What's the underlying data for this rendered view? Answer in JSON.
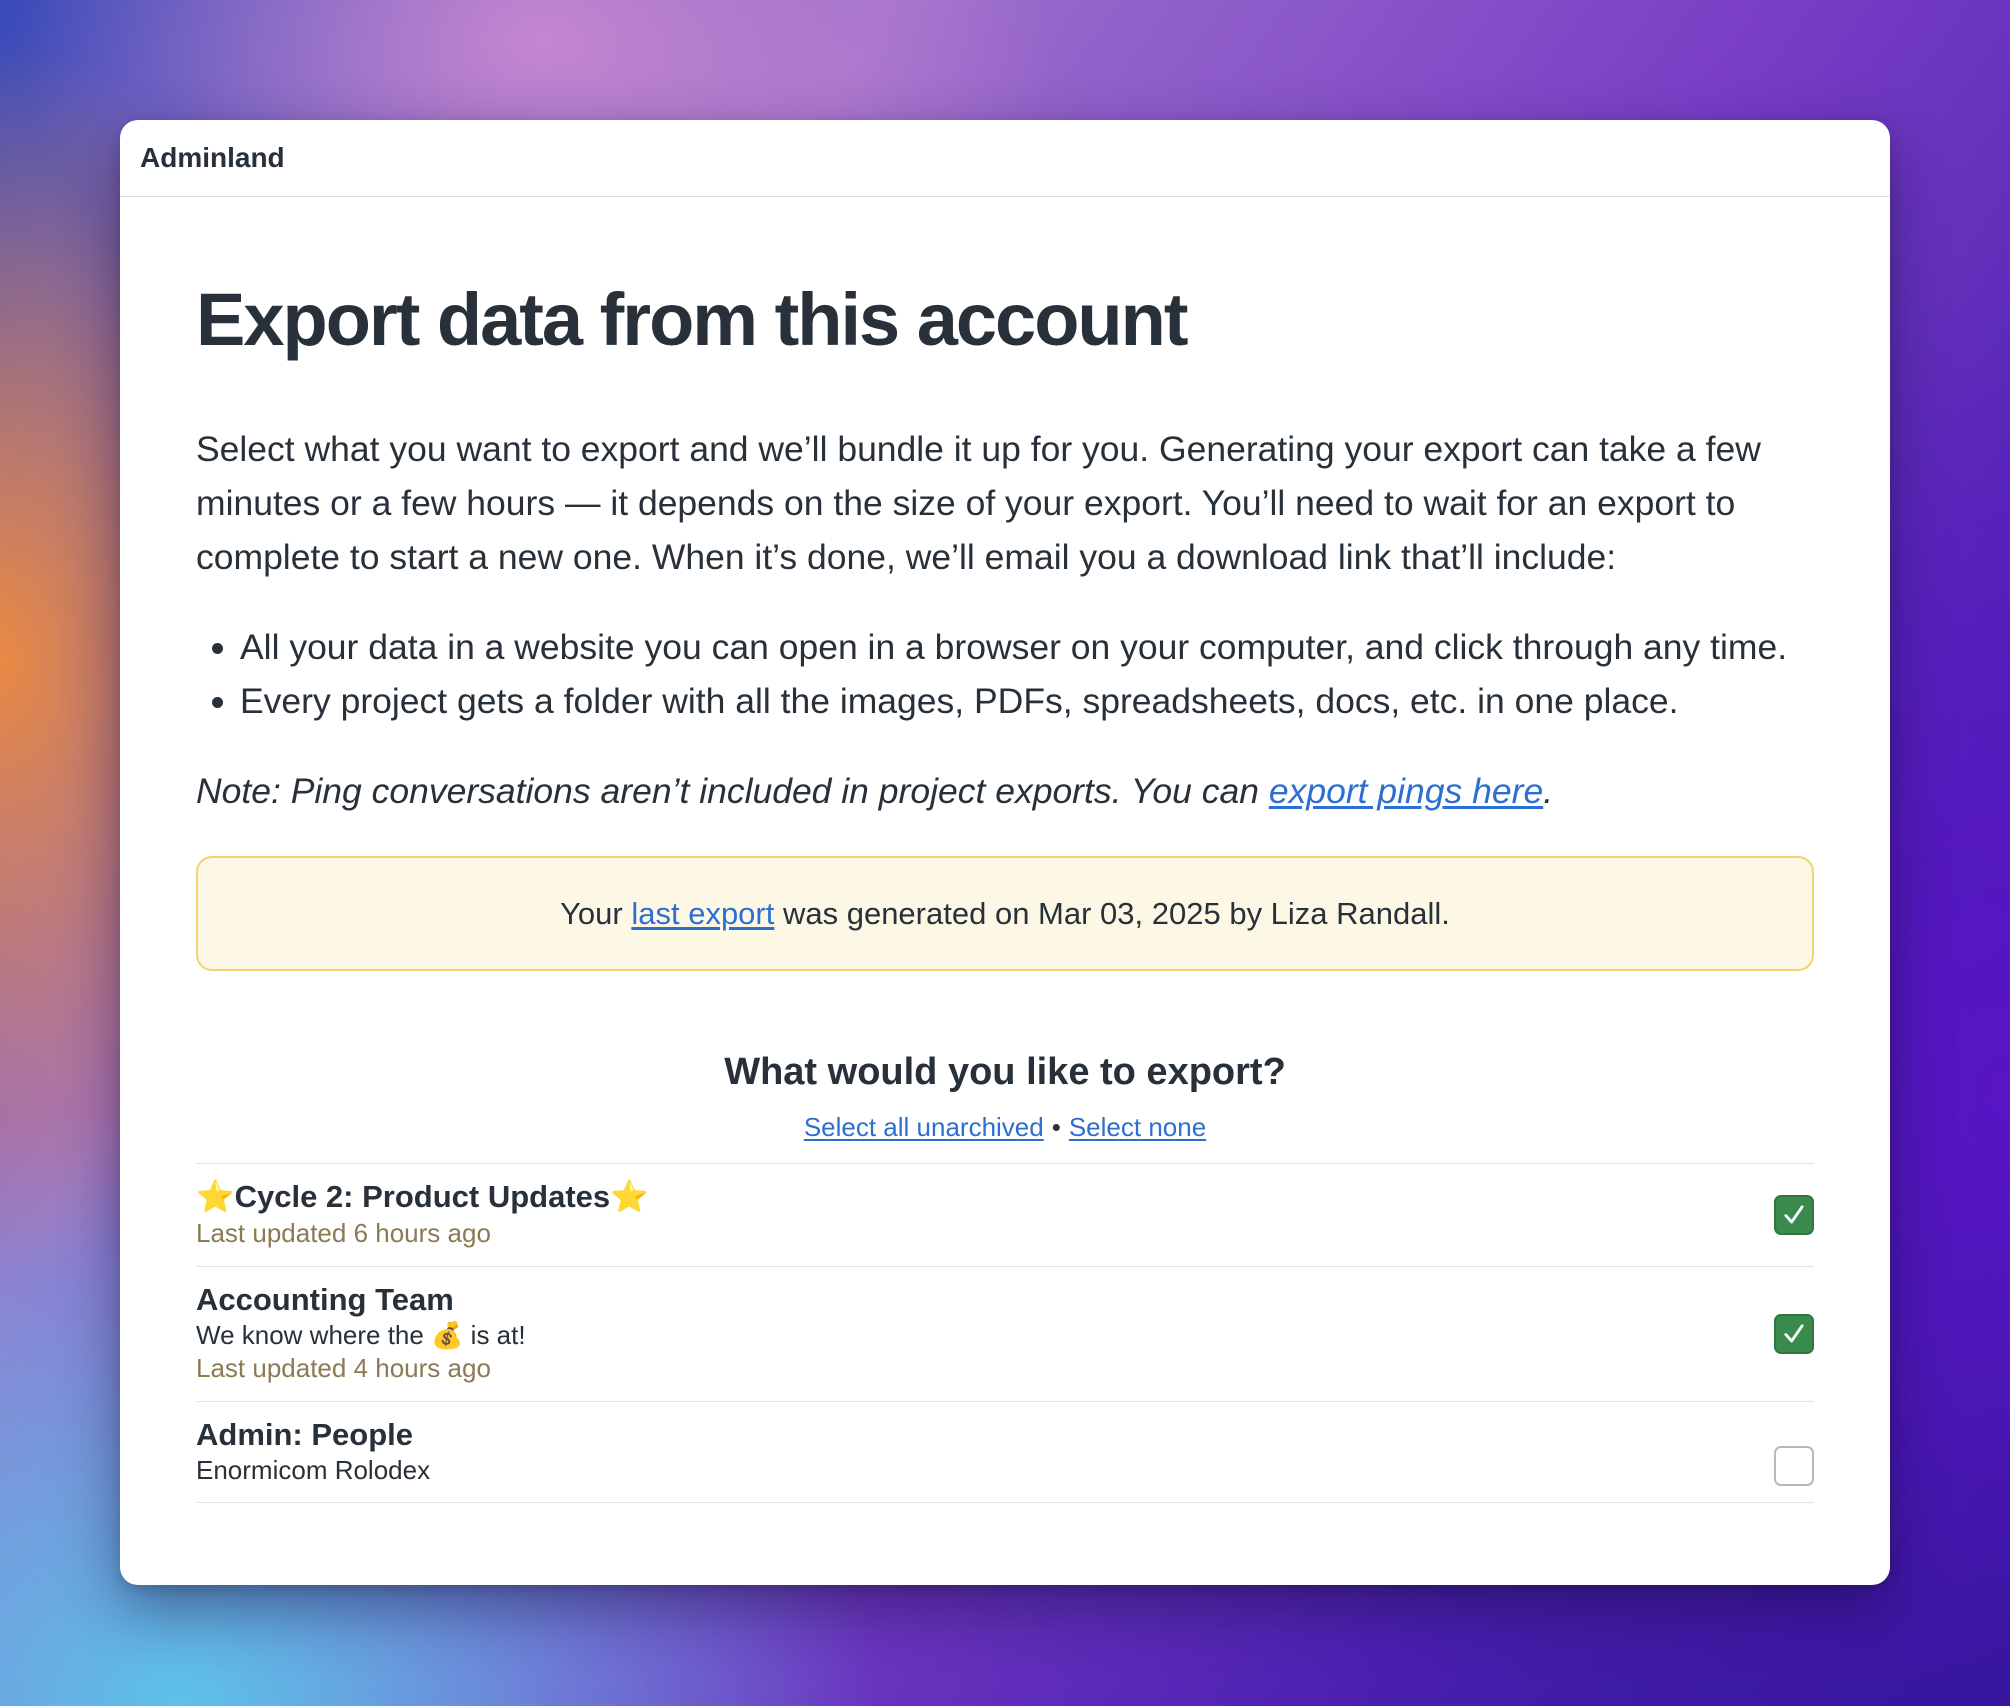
{
  "window": {
    "title": "Adminland"
  },
  "page": {
    "title": "Export data from this account",
    "intro": "Select what you want to export and we’ll bundle it up for you. Generating your export can take a few minutes or a few hours — it depends on the size of your export. You’ll need to wait for an export to complete to start a new one. When it’s done, we’ll email you a download link that’ll include:",
    "bullets": [
      "All your data in a website you can open in a browser on your computer, and click through any time.",
      "Every project gets a folder with all the images, PDFs, spreadsheets, docs, etc. in one place."
    ],
    "note": {
      "prefix": "Note: Ping conversations aren’t included in project exports. You can ",
      "link": "export pings here",
      "suffix": "."
    }
  },
  "notice": {
    "prefix": "Your ",
    "link": "last export",
    "suffix": " was generated on Mar 03, 2025 by Liza Randall."
  },
  "export_section": {
    "heading": "What would you like to export?",
    "select_all": "Select all unarchived",
    "separator": "•",
    "select_none": "Select none"
  },
  "projects": [
    {
      "name": "⭐Cycle 2: Product Updates⭐",
      "description": "",
      "updated": "Last updated 6 hours ago",
      "checked": true
    },
    {
      "name": "Accounting Team",
      "description": "We know where the 💰 is at!",
      "updated": "Last updated 4 hours ago",
      "checked": true
    },
    {
      "name": "Admin: People",
      "description": "Enormicom Rolodex",
      "updated": "",
      "checked": false
    }
  ],
  "colors": {
    "link": "#2c6fd0",
    "checkbox_checked": "#3a8a4e",
    "notice_bg": "#fdf8e6",
    "notice_border": "#f0d66c",
    "updated_text": "#8c7a55"
  }
}
